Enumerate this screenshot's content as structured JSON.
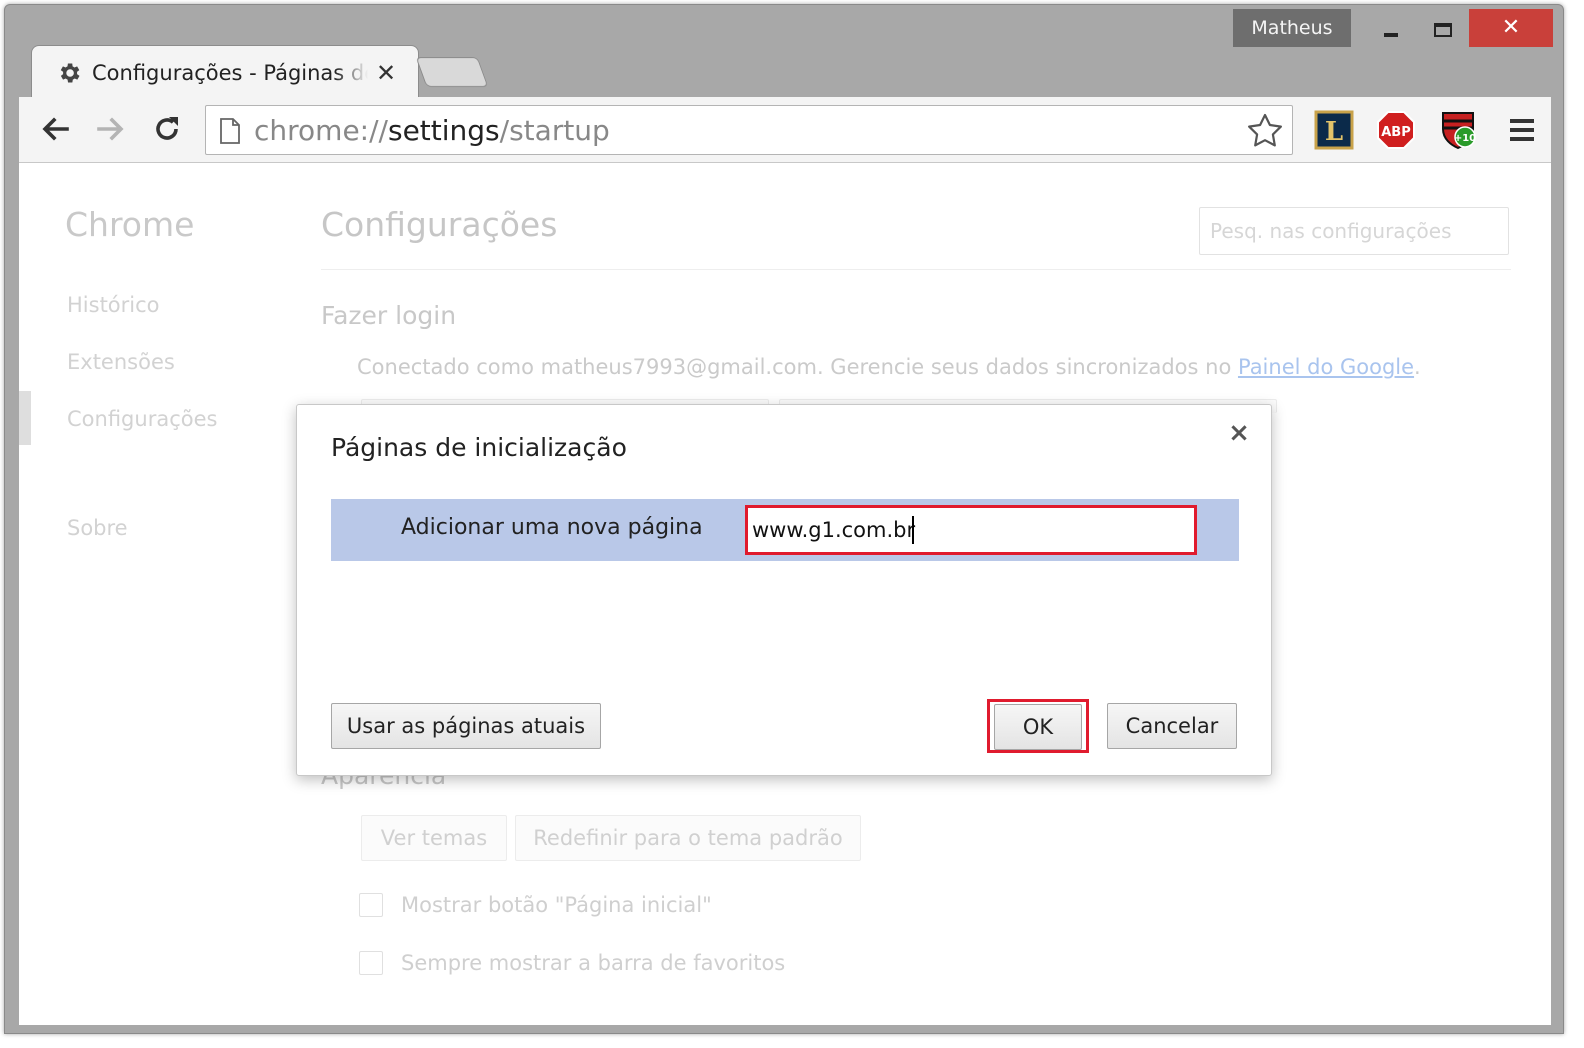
{
  "window": {
    "profile_name": "Matheus",
    "controls": {
      "minimize": "minimize",
      "maximize": "maximize",
      "close": "✕"
    }
  },
  "tab": {
    "title": "Configurações - Páginas de inicialização",
    "close": "✕",
    "icon": "gear-icon"
  },
  "toolbar": {
    "url_scheme": "chrome://",
    "url_host": "settings",
    "url_path": "/startup",
    "icons": [
      "back-arrow-icon",
      "forward-arrow-icon",
      "reload-icon",
      "page-icon",
      "star-icon"
    ],
    "extensions": [
      {
        "name": "league-extension-icon",
        "label": "L"
      },
      {
        "name": "adblock-plus-icon",
        "label": "ABP"
      },
      {
        "name": "flamengo-extension-icon",
        "label": "+10"
      }
    ],
    "menu_icon": "hamburger-menu-icon"
  },
  "sidebar": {
    "title": "Chrome",
    "items": [
      "Histórico",
      "Extensões",
      "Configurações",
      "Sobre"
    ],
    "active": "Configurações"
  },
  "settings": {
    "title": "Configurações",
    "search_placeholder": "Pesq. nas configurações",
    "login_heading": "Fazer login",
    "login_text": "Conectado como matheus7993@gmail.com. Gerencie seus dados sincronizados no ",
    "login_link": "Painel do Google",
    "login_text_end": ".",
    "appearance_heading": "Aparência",
    "theme_button": "Ver temas",
    "reset_theme_button": "Redefinir para o tema padrão",
    "checkbox_home": "Mostrar botão \"Página inicial\"",
    "checkbox_bookmarks": "Sempre mostrar a barra de favoritos"
  },
  "dialog": {
    "title": "Páginas de inicialização",
    "close": "×",
    "row_label": "Adicionar uma nova página",
    "input_value": "www.g1.com.br",
    "use_current_button": "Usar as páginas atuais",
    "ok_button": "OK",
    "cancel_button": "Cancelar"
  },
  "colors": {
    "highlight_red": "#e01b2e",
    "dialog_row_blue": "#b9c8e8",
    "close_red": "#c9403a",
    "link_blue": "#a9c4ee"
  }
}
